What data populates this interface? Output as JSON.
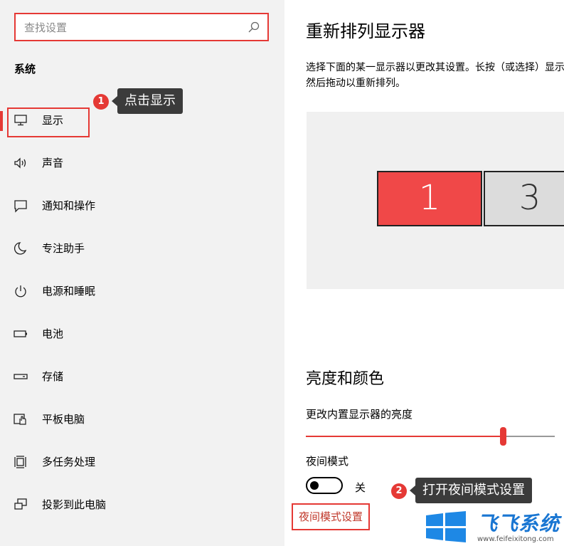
{
  "search": {
    "placeholder": "查找设置",
    "icon": "search-icon"
  },
  "sidebar": {
    "section_title": "系统",
    "items": [
      {
        "label": "显示",
        "icon": "monitor-icon",
        "active": true
      },
      {
        "label": "声音",
        "icon": "speaker-icon"
      },
      {
        "label": "通知和操作",
        "icon": "notification-icon"
      },
      {
        "label": "专注助手",
        "icon": "moon-icon"
      },
      {
        "label": "电源和睡眠",
        "icon": "power-icon"
      },
      {
        "label": "电池",
        "icon": "battery-icon"
      },
      {
        "label": "存储",
        "icon": "storage-icon"
      },
      {
        "label": "平板电脑",
        "icon": "tablet-icon"
      },
      {
        "label": "多任务处理",
        "icon": "multitask-icon"
      },
      {
        "label": "投影到此电脑",
        "icon": "project-icon"
      }
    ]
  },
  "annotations": {
    "step1": {
      "number": "1",
      "text": "点击显示"
    },
    "step2": {
      "number": "2",
      "text": "打开夜间模式设置"
    }
  },
  "main": {
    "rearrange_title": "重新排列显示器",
    "rearrange_desc": "选择下面的某一显示器以更改其设置。长按（或选择）显示器，然后拖动以重新排列。",
    "monitors": [
      "1",
      "3"
    ],
    "brightness_title": "亮度和颜色",
    "brightness_label": "更改内置显示器的亮度",
    "brightness_value": 80,
    "night_mode_label": "夜间模式",
    "night_mode_state": "关",
    "night_mode_on": false,
    "night_mode_link": "夜间模式设置"
  },
  "watermark": {
    "title": "飞飞系统",
    "url": "www.feifeixitong.com"
  },
  "colors": {
    "accent": "#e53935",
    "primary_monitor": "#f04848",
    "watermark": "#1976d2"
  }
}
